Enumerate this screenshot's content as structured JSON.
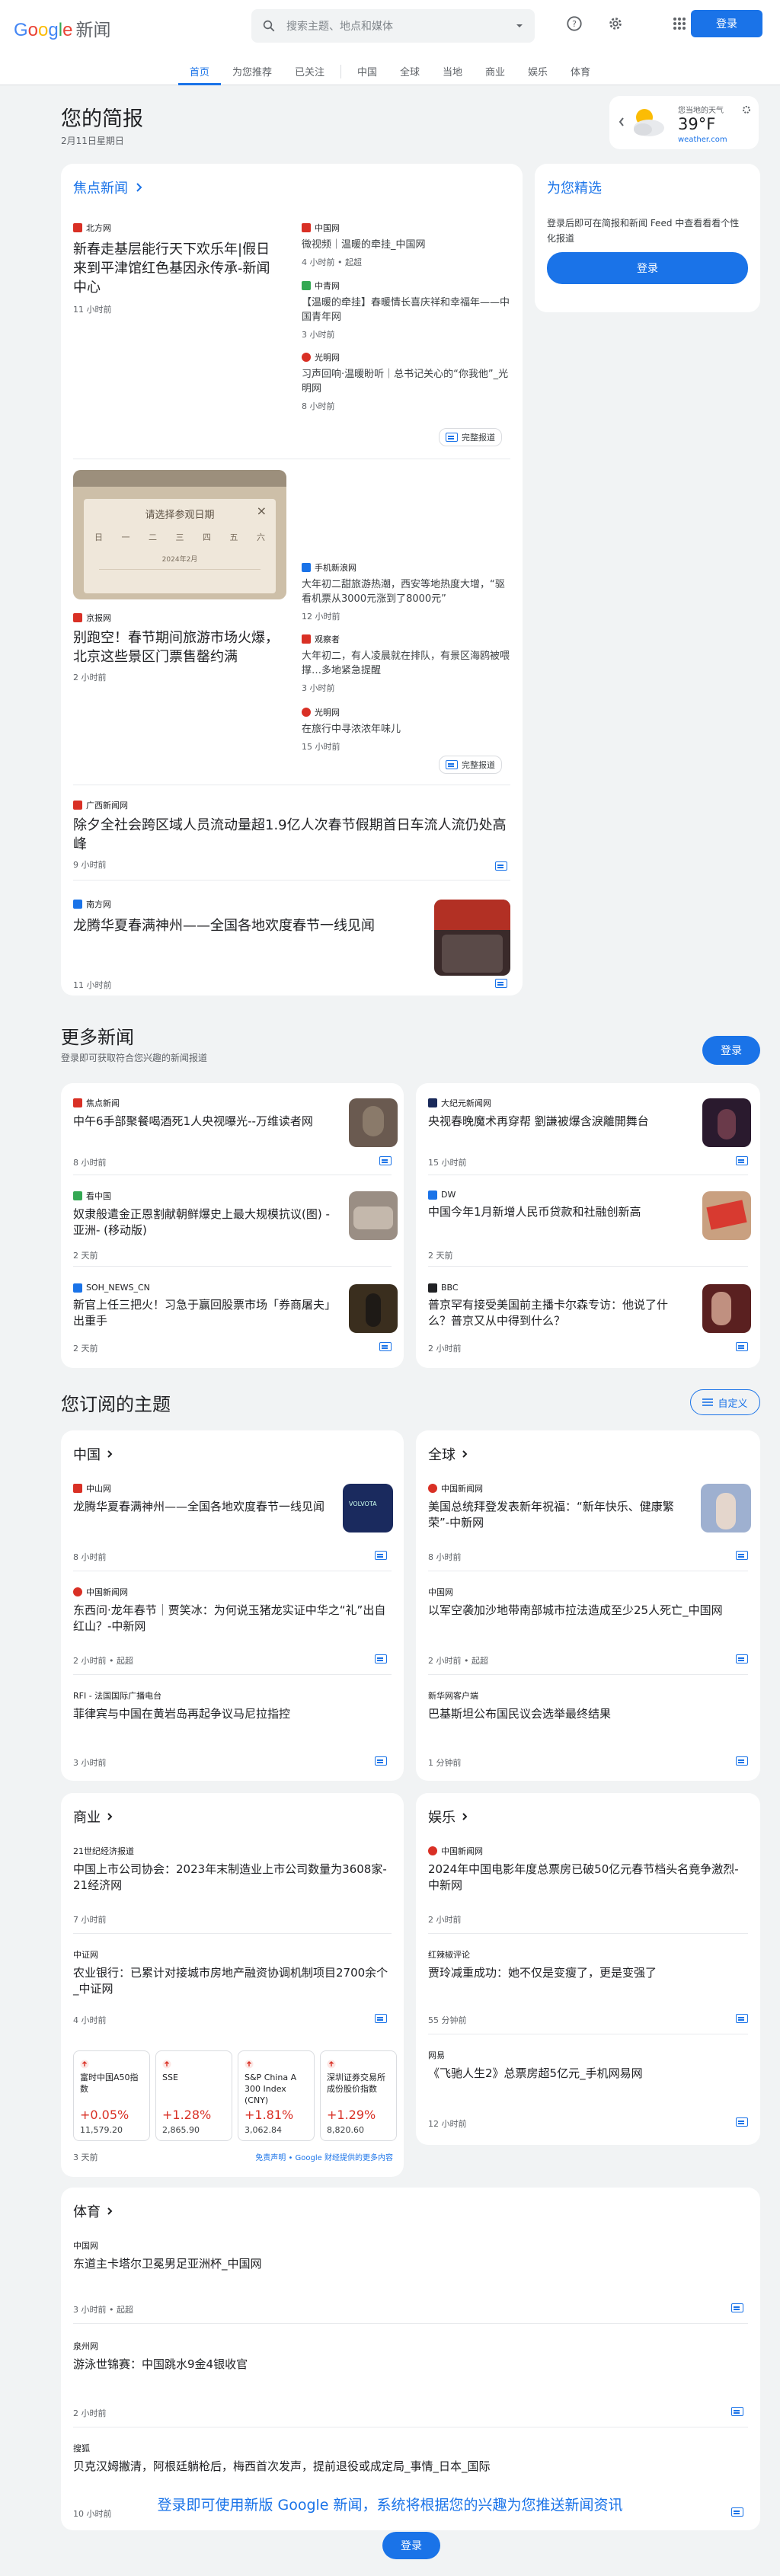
{
  "header": {
    "logo_word": "Google",
    "logo_news": "新闻",
    "search_placeholder": "搜索主题、地点和媒体",
    "login": "登录"
  },
  "nav": {
    "tabs": [
      "首页",
      "为您推荐",
      "已关注",
      "中国",
      "全球",
      "当地",
      "商业",
      "娱乐",
      "体育"
    ]
  },
  "briefing": {
    "title": "您的简报",
    "date": "2月11日星期日"
  },
  "weather": {
    "label": "您当地的天气",
    "temp": "39°F",
    "source": "weather.com"
  },
  "headlines": {
    "title": "焦点新闻",
    "c1": {
      "main": {
        "source": "北方网",
        "title": "新春走基层能行天下欢乐年|假日来到平津馆红色基因永传承-新闻中心",
        "time": "11 小时前"
      },
      "side": [
        {
          "source": "中国网",
          "title": "微视频｜温暖的牵挂_中国网",
          "time": "4 小时前 • 起超"
        },
        {
          "source": "中青网",
          "title": "【温暖的牵挂】春暖情长喜庆祥和幸福年——中国青年网",
          "time": "3 小时前"
        },
        {
          "source": "光明网",
          "title": "习声回响·温暖盼听｜总书记关心的“你我他”_光明网",
          "time": "8 小时前"
        }
      ],
      "coverage": "完整报道"
    },
    "c2": {
      "main": {
        "source": "京报网",
        "title": "别跑空！春节期间旅游市场火爆，北京这些景区门票售罄约满",
        "time": "2 小时前"
      },
      "image": {
        "calendar_title": "请选择参观日期",
        "year_month": "2024年2月",
        "days": [
          "日",
          "一",
          "二",
          "三",
          "四",
          "五",
          "六"
        ],
        "close": "×"
      },
      "side": [
        {
          "source": "手机新浪网",
          "title": "大年初二甜旅游热潮，西安等地热度大增，“驱看机票从3000元涨到了8000元”",
          "time": "12 小时前"
        },
        {
          "source": "观察者",
          "title": "大年初二，有人凌晨就在排队，有景区海鸥被喂撑…多地紧急提醒",
          "time": "3 小时前"
        },
        {
          "source": "光明网",
          "title": "在旅行中寻浓浓年味儿",
          "time": "15 小时前"
        }
      ],
      "coverage": "完整报道"
    },
    "s1": {
      "source": "广西新闻网",
      "title": "除夕全社会跨区域人员流动量超1.9亿人次春节假期首日车流人流仍处高峰",
      "time": "9 小时前"
    },
    "s2": {
      "source": "南方网",
      "title": "龙腾华夏春满神州——全国各地欢度春节一线见闻",
      "time": "11 小时前"
    }
  },
  "picks": {
    "title": "为您精选",
    "desc": "登录后即可在简报和新闻 Feed 中查看看看个性化报道",
    "login": "登录"
  },
  "more": {
    "title": "更多新闻",
    "subtitle": "登录即可获取符合您兴趣的新闻报道",
    "login": "登录",
    "items": [
      {
        "source": "焦点新闻",
        "title": "中午6手部聚餐喝酒死1人央视曝光--万维读者网",
        "time": "8 小时前"
      },
      {
        "source": "大纪元新闻网",
        "title": "央视春晚魔术再穿帮 劉謙被爆含淚離開舞台",
        "time": "15 小时前"
      },
      {
        "source": "看中国",
        "title": "奴隶般遣金正恩割献朝鲜爆史上最大规模抗议(图) - 亚洲- (移动版)",
        "time": "2 天前"
      },
      {
        "source": "DW",
        "title": "中国今年1月新增人民币贷款和社融创新高",
        "time": "2 天前"
      },
      {
        "source": "SOH_NEWS_CN",
        "title": "新官上任三把火！习急于赢回股票市场「券商屠夫」出重手",
        "time": "2 天前"
      },
      {
        "source": "BBC",
        "title": "普京罕有接受美国前主播卡尔森专访：他说了什么？普京又从中得到什么？",
        "time": "2 小时前"
      }
    ]
  },
  "topics": {
    "title": "您订阅的主题",
    "customize": "自定义",
    "china": {
      "title": "中国",
      "items": [
        {
          "source": "中山网",
          "title": "龙腾华夏春满神州——全国各地欢度春节一线见闻",
          "time": "8 小时前",
          "thumb_text": "VOLVOTA"
        },
        {
          "source": "中国新闻网",
          "title": "东西问·龙年春节｜贾笑冰：为何说玉猪龙实证中华之“礼”出自红山？-中新网",
          "time": "2 小时前 • 起超"
        },
        {
          "source": "RFI - 法国国际广播电台",
          "title": "菲律宾与中国在黄岩岛再起争议马尼拉指控",
          "time": "3 小时前"
        }
      ]
    },
    "world": {
      "title": "全球",
      "items": [
        {
          "source": "中国新闻网",
          "title": "美国总统拜登发表新年祝福：“新年快乐、健康繁荣”-中新网",
          "time": "8 小时前"
        },
        {
          "source": "中国网",
          "title": "以军空袭加沙地带南部城市拉法造成至少25人死亡_中国网",
          "time": "2 小时前 • 起超"
        },
        {
          "source": "新华网客户端",
          "title": "巴基斯坦公布国民议会选举最终结果",
          "time": "1 分钟前"
        }
      ]
    },
    "business": {
      "title": "商业",
      "items": [
        {
          "source": "21世纪经济报道",
          "title": "中国上市公司协会：2023年末制造业上市公司数量为3608家- 21经济网",
          "time": "7 小时前"
        },
        {
          "source": "中证网",
          "title": "农业银行：已累计对接城市房地产融资协调机制项目2700余个_中证网",
          "time": "4 小时前"
        }
      ],
      "stocks": [
        {
          "name": "富时中国A50指数",
          "change": "+0.05%",
          "value": "11,579.20"
        },
        {
          "name": "SSE",
          "change": "+1.28%",
          "value": "2,865.90"
        },
        {
          "name": "S&P China A 300 Index (CNY)",
          "change": "+1.81%",
          "value": "3,062.84"
        },
        {
          "name": "深圳证券交易所成份股价指数",
          "change": "+1.29%",
          "value": "8,820.60"
        }
      ],
      "stocks_time": "3 天前",
      "disclaimer": "免责声明 • Google 财经提供的更多内容"
    },
    "entertainment": {
      "title": "娱乐",
      "items": [
        {
          "source": "中国新闻网",
          "title": "2024年中国电影年度总票房已破50亿元春节档头名竟争激烈-中新网",
          "time": "2 小时前"
        },
        {
          "source": "红辣椒评论",
          "title": "贾玲减重成功：她不仅是变瘦了，更是变强了",
          "time": "55 分钟前"
        },
        {
          "source": "网易",
          "title": "《飞驰人生2》总票房超5亿元_手机网易网",
          "time": "12 小时前"
        }
      ]
    },
    "sports": {
      "title": "体育",
      "items": [
        {
          "source": "中国网",
          "title": "东道主卡塔尔卫冕男足亚洲杯_中国网",
          "time": "3 小时前 • 起超"
        },
        {
          "source": "泉州网",
          "title": "游泳世锦赛：中国跳水9金4银收官",
          "time": "2 小时前"
        },
        {
          "source": "搜狐",
          "title": "贝克汉姆撇清，阿根廷躺枪后，梅西首次发声，提前退役或成定局_事情_日本_国际",
          "time": "10 小时前"
        }
      ]
    }
  },
  "footer": {
    "text": "登录即可使用新版 Google 新闻，系统将根据您的兴趣为您推送新闻资讯",
    "login": "登录"
  },
  "colors": {
    "accent": "#1a73e8",
    "red": "#d93025"
  }
}
